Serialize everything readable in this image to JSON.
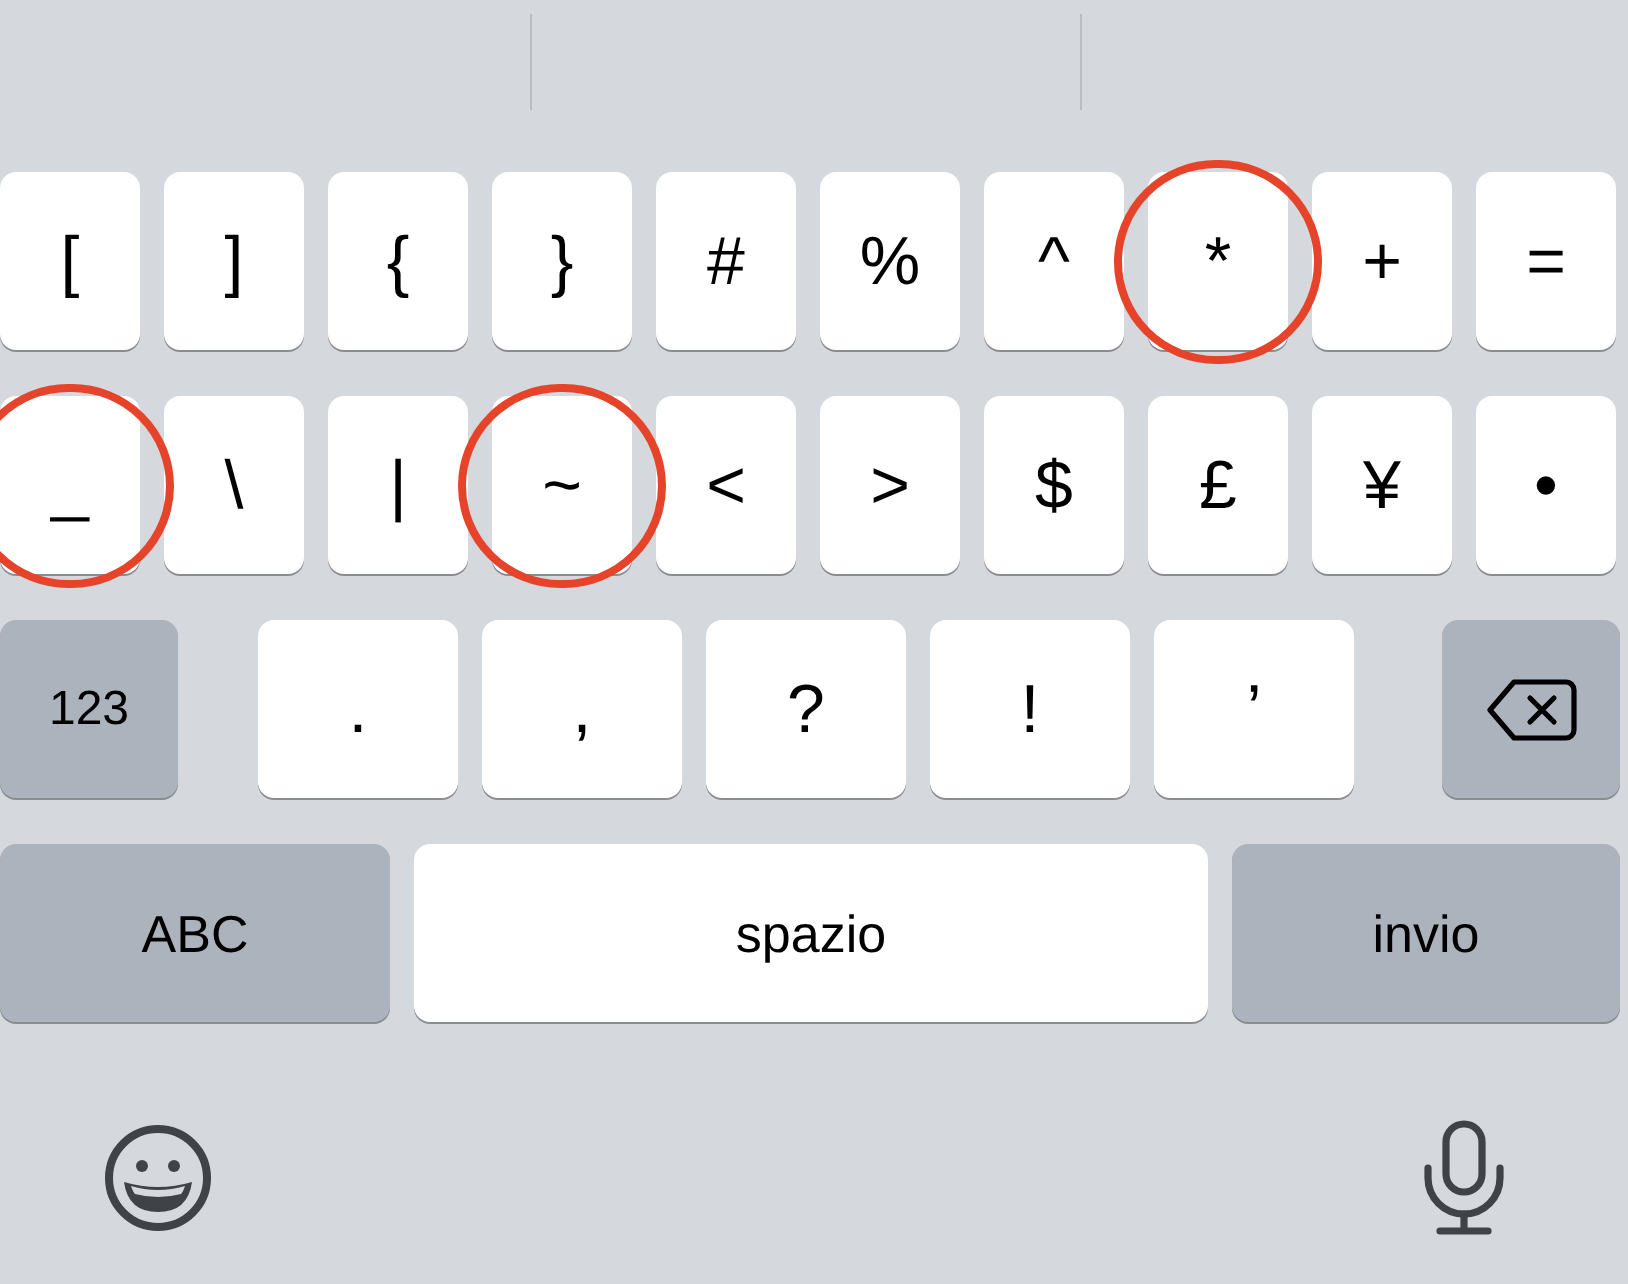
{
  "keyboard": {
    "rows": [
      {
        "keys": [
          {
            "kind": "symbol",
            "label": "[",
            "circled": false
          },
          {
            "kind": "symbol",
            "label": "]",
            "circled": false
          },
          {
            "kind": "symbol",
            "label": "{",
            "circled": false
          },
          {
            "kind": "symbol",
            "label": "}",
            "circled": false
          },
          {
            "kind": "symbol",
            "label": "#",
            "circled": false
          },
          {
            "kind": "symbol",
            "label": "%",
            "circled": false
          },
          {
            "kind": "symbol",
            "label": "^",
            "circled": false
          },
          {
            "kind": "symbol",
            "label": "*",
            "circled": true
          },
          {
            "kind": "symbol",
            "label": "+",
            "circled": false
          },
          {
            "kind": "symbol",
            "label": "=",
            "circled": false
          }
        ]
      },
      {
        "keys": [
          {
            "kind": "symbol",
            "label": "_",
            "circled": true
          },
          {
            "kind": "symbol",
            "label": "\\",
            "circled": false
          },
          {
            "kind": "symbol",
            "label": "|",
            "circled": false
          },
          {
            "kind": "symbol",
            "label": "~",
            "circled": true
          },
          {
            "kind": "symbol",
            "label": "<",
            "circled": false
          },
          {
            "kind": "symbol",
            "label": ">",
            "circled": false
          },
          {
            "kind": "symbol",
            "label": "$",
            "circled": false
          },
          {
            "kind": "symbol",
            "label": "£",
            "circled": false
          },
          {
            "kind": "symbol",
            "label": "¥",
            "circled": false
          },
          {
            "kind": "symbol",
            "label": "•",
            "circled": false
          }
        ]
      },
      {
        "keys": [
          {
            "kind": "numbers",
            "label": "123",
            "circled": false
          },
          {
            "kind": "punct",
            "label": ".",
            "circled": false
          },
          {
            "kind": "punct",
            "label": ",",
            "circled": false
          },
          {
            "kind": "punct",
            "label": "?",
            "circled": false
          },
          {
            "kind": "punct",
            "label": "!",
            "circled": false
          },
          {
            "kind": "punct",
            "label": "’",
            "circled": false
          },
          {
            "kind": "delete",
            "circled": false
          }
        ]
      },
      {
        "keys": [
          {
            "kind": "letters",
            "label": "ABC",
            "circled": false
          },
          {
            "kind": "space",
            "label": "spazio",
            "circled": false
          },
          {
            "kind": "return",
            "label": "invio",
            "circled": false
          }
        ]
      }
    ]
  }
}
